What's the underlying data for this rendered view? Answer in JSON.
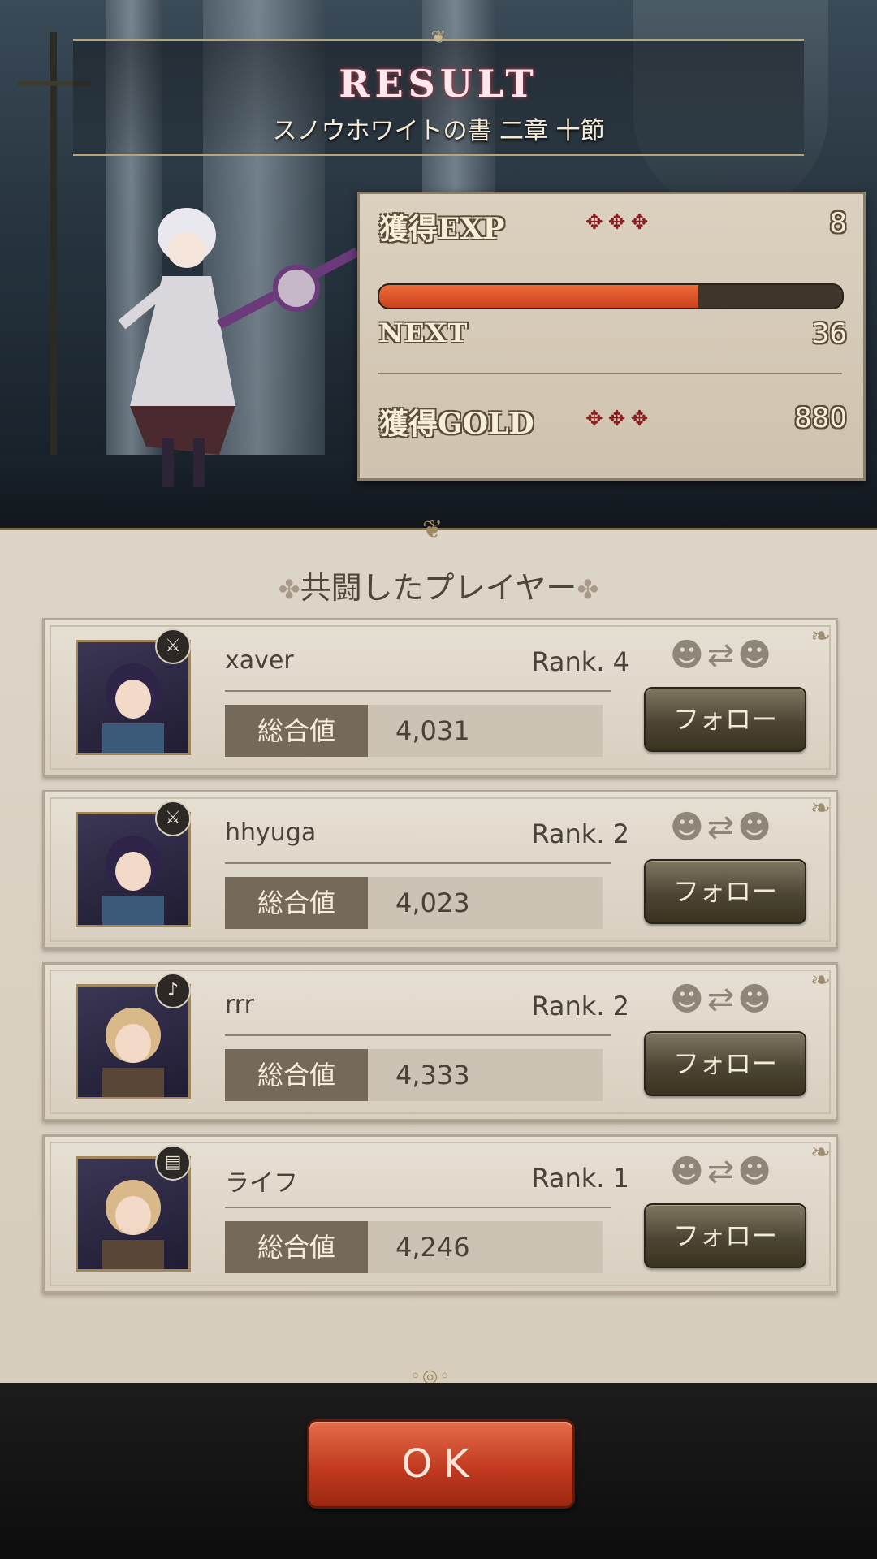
{
  "header": {
    "title": "RESULT",
    "subtitle": "スノウホワイトの書 二章 十節"
  },
  "stats": {
    "exp_label": "獲得EXP",
    "exp_value": "8",
    "exp_progress": 0.69,
    "next_label": "NEXT",
    "next_value": "36",
    "gold_label": "獲得GOLD",
    "gold_value": "880",
    "crosses": "✥✥✥"
  },
  "players_panel": {
    "heading": "共闘したプレイヤー",
    "score_label": "総合値",
    "follow_label": "フォロー",
    "players": [
      {
        "name": "xaver",
        "rank": "Rank. 4",
        "score": "4,031",
        "badge_icon": "sword-icon",
        "badge": "⚔"
      },
      {
        "name": "hhyuga",
        "rank": "Rank. 2",
        "score": "4,023",
        "badge_icon": "sword-icon",
        "badge": "⚔"
      },
      {
        "name": "rrr",
        "rank": "Rank. 2",
        "score": "4,333",
        "badge_icon": "harp-icon",
        "badge": "♪"
      },
      {
        "name": "ライフ",
        "rank": "Rank. 1",
        "score": "4,246",
        "badge_icon": "book-icon",
        "badge": "▤"
      }
    ]
  },
  "footer": {
    "ok_label": "OK"
  },
  "colors": {
    "accent_red": "#c13a20",
    "exp_fill": "#e05a2c",
    "panel_bg": "#ddd5c8",
    "follow_btn": "#4c4534"
  }
}
